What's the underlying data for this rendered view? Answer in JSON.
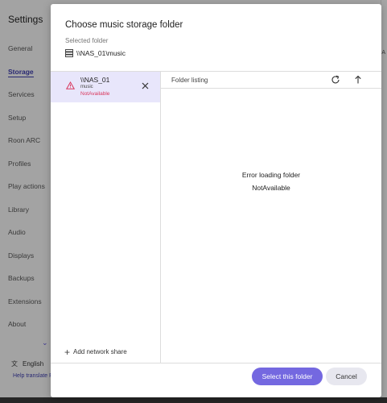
{
  "background": {
    "title": "Settings",
    "nav": [
      "General",
      "Storage",
      "Services",
      "Setup",
      "Roon ARC",
      "Profiles",
      "Play actions",
      "Library",
      "Audio",
      "Displays",
      "Backups",
      "Extensions",
      "About"
    ],
    "active_nav": "Storage",
    "language": "English",
    "help_link": "Help translate Ro",
    "right_edge_char": "A"
  },
  "dialog": {
    "title": "Choose music storage folder",
    "selected_label": "Selected folder",
    "selected_path": "\\\\NAS_01\\music",
    "share": {
      "name": "\\\\NAS_01",
      "sub": "music",
      "status": "NotAvailable"
    },
    "add_share_label": "Add network share",
    "listing_title": "Folder listing",
    "error_title": "Error loading folder",
    "error_detail": "NotAvailable",
    "primary_button": "Select this folder",
    "cancel_button": "Cancel"
  },
  "colors": {
    "accent": "#7468e0",
    "selected_item_bg": "#e8e6fb",
    "error": "#d9365c"
  }
}
